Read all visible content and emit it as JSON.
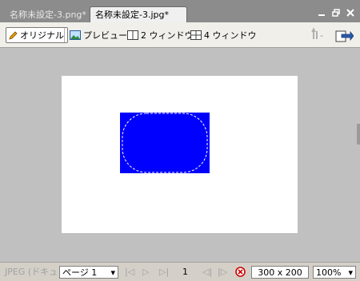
{
  "tabs": [
    {
      "label": "名称未設定-3.png*",
      "active": false
    },
    {
      "label": "名称未設定-3.jpg*",
      "active": true
    }
  ],
  "window_controls": {
    "minimize_icon": "minimize-icon",
    "restore_icon": "restore-icon",
    "close_icon": "close-icon"
  },
  "toolbar": {
    "original_label": "オリジナル",
    "preview_label": "プレビュー",
    "two_window_label": "2 ウィンドウ",
    "four_window_label": "4 ウィンドウ"
  },
  "canvas": {
    "background": "#c0c0c0",
    "paper_color": "#ffffff",
    "shape_color": "#0000ff"
  },
  "status": {
    "format_text": "JPEG (ドキュ",
    "page_select": "ページ 1",
    "page_number": "1",
    "dimensions": "300 x 200",
    "zoom": "100%"
  }
}
